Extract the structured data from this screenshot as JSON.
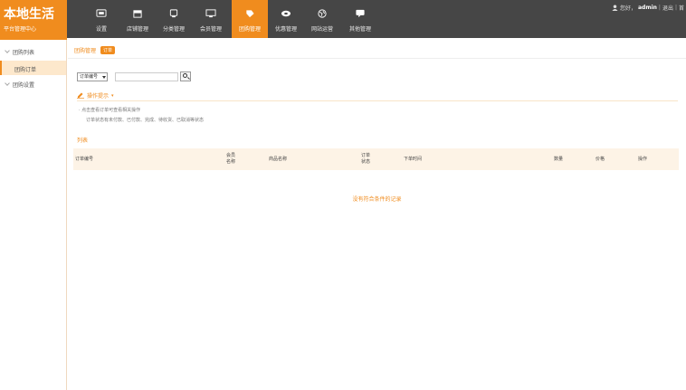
{
  "brand": {
    "title": "本地生活",
    "subtitle": "平台管理中心",
    "color": "#f08c1e"
  },
  "nav": [
    {
      "label": "设置",
      "icon": "settings-icon",
      "active": false
    },
    {
      "label": "店铺管理",
      "icon": "store-icon",
      "active": false
    },
    {
      "label": "分类管理",
      "icon": "category-icon",
      "active": false
    },
    {
      "label": "会员管理",
      "icon": "monitor-icon",
      "active": false
    },
    {
      "label": "团购管理",
      "icon": "tag-icon",
      "active": true
    },
    {
      "label": "优惠管理",
      "icon": "coupon-icon",
      "active": false
    },
    {
      "label": "网站运营",
      "icon": "globe-icon",
      "active": false
    },
    {
      "label": "其他管理",
      "icon": "chat-icon",
      "active": false
    }
  ],
  "user": {
    "greeting": "您好，",
    "name": "admin",
    "sep1": "|",
    "link1": "退出",
    "sep2": "|",
    "link2": "首"
  },
  "sidebar": {
    "items": [
      {
        "label": "团购列表",
        "active": false
      },
      {
        "label": "团购订单",
        "active": true
      },
      {
        "label": "团购设置",
        "active": false
      }
    ]
  },
  "breadcrumb": {
    "title": "团购管理",
    "tab": "订单"
  },
  "search": {
    "select_value": "订单编号",
    "input_value": ""
  },
  "tips": {
    "title": "操作提示",
    "line1": "· 点击查看订单可查看相关操作",
    "line2": "订单状态有未付款、已付款、完成、待收货、已取消等状态"
  },
  "list": {
    "label": "列表",
    "columns": [
      "订单编号",
      "会员名称",
      "商品名称",
      "订单状态",
      "下单时间",
      "数量",
      "价格",
      "操作"
    ],
    "empty_text": "没有符合条件的记录"
  }
}
